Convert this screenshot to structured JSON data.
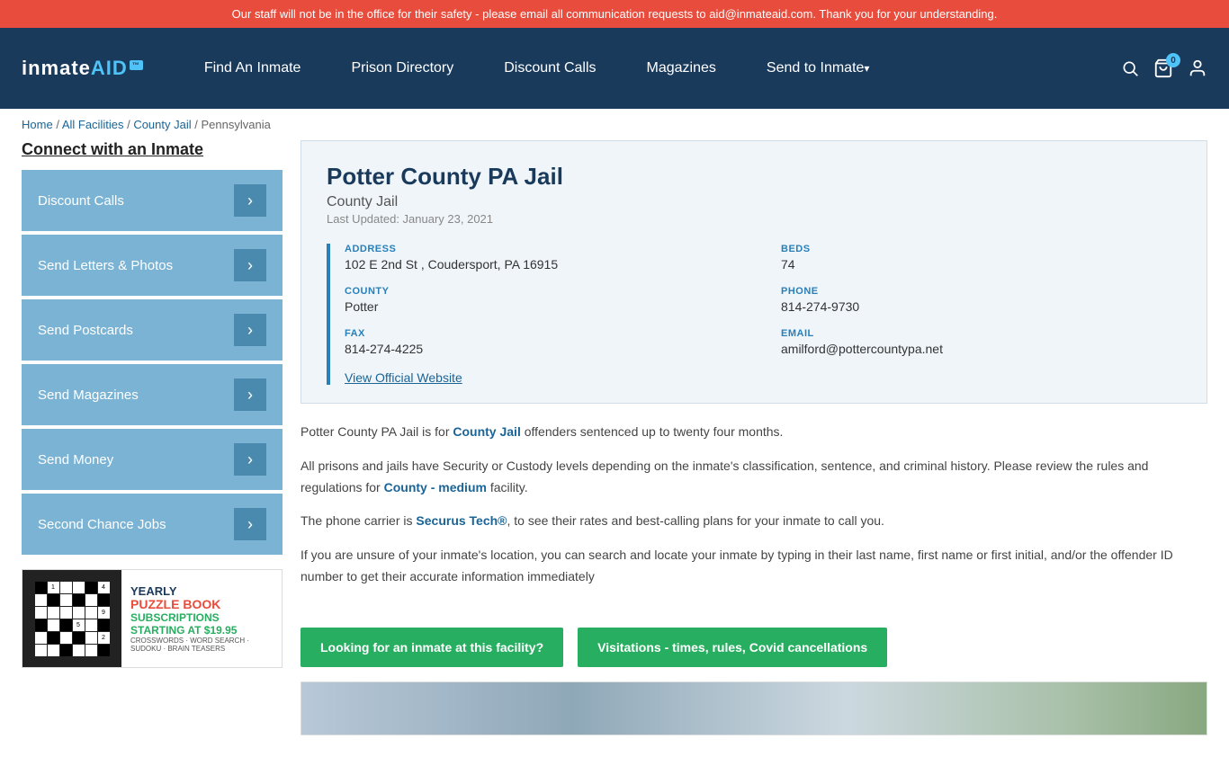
{
  "banner": {
    "text": "Our staff will not be in the office for their safety - please email all communication requests to aid@inmateaid.com. Thank you for your understanding."
  },
  "navbar": {
    "logo": "inmate",
    "logo_suffix": "AID",
    "logo_badge": "™",
    "links": [
      {
        "id": "find-inmate",
        "label": "Find An Inmate",
        "has_arrow": false
      },
      {
        "id": "prison-directory",
        "label": "Prison Directory",
        "has_arrow": false
      },
      {
        "id": "discount-calls",
        "label": "Discount Calls",
        "has_arrow": false
      },
      {
        "id": "magazines",
        "label": "Magazines",
        "has_arrow": false
      },
      {
        "id": "send-to-inmate",
        "label": "Send to Inmate",
        "has_arrow": true
      }
    ],
    "cart_count": "0"
  },
  "breadcrumb": {
    "items": [
      "Home",
      "All Facilities",
      "County Jail",
      "Pennsylvania"
    ]
  },
  "sidebar": {
    "title": "Connect with an Inmate",
    "buttons": [
      {
        "id": "discount-calls",
        "label": "Discount Calls"
      },
      {
        "id": "send-letters",
        "label": "Send Letters & Photos"
      },
      {
        "id": "send-postcards",
        "label": "Send Postcards"
      },
      {
        "id": "send-magazines",
        "label": "Send Magazines"
      },
      {
        "id": "send-money",
        "label": "Send Money"
      },
      {
        "id": "second-chance",
        "label": "Second Chance Jobs"
      }
    ],
    "ad": {
      "title_yearly": "YEARLY",
      "title_puzzle": "PUZZLE BOOK",
      "title_subscriptions": "SUBSCRIPTIONS",
      "starting_at": "STARTING AT $19.95",
      "types": "CROSSWORDS · WORD SEARCH · SUDOKU · BRAIN TEASERS"
    }
  },
  "facility": {
    "name": "Potter County PA Jail",
    "type": "County Jail",
    "last_updated": "Last Updated: January 23, 2021",
    "address_label": "ADDRESS",
    "address_value": "102 E 2nd St , Coudersport, PA 16915",
    "beds_label": "BEDS",
    "beds_value": "74",
    "county_label": "COUNTY",
    "county_value": "Potter",
    "phone_label": "PHONE",
    "phone_value": "814-274-9730",
    "fax_label": "FAX",
    "fax_value": "814-274-4225",
    "email_label": "EMAIL",
    "email_value": "amilford@pottercountypa.net",
    "website_label": "View Official Website"
  },
  "description": {
    "para1_pre": "Potter County PA Jail is for ",
    "para1_link": "County Jail",
    "para1_post": " offenders sentenced up to twenty four months.",
    "para2": "All prisons and jails have Security or Custody levels depending on the inmate's classification, sentence, and criminal history. Please review the rules and regulations for ",
    "para2_link": "County - medium",
    "para2_post": " facility.",
    "para3_pre": "The phone carrier is ",
    "para3_link": "Securus Tech®",
    "para3_post": ", to see their rates and best-calling plans for your inmate to call you.",
    "para4": "If you are unsure of your inmate's location, you can search and locate your inmate by typing in their last name, first name or first initial, and/or the offender ID number to get their accurate information immediately"
  },
  "action_buttons": {
    "btn1": "Looking for an inmate at this facility?",
    "btn2": "Visitations - times, rules, Covid cancellations"
  }
}
